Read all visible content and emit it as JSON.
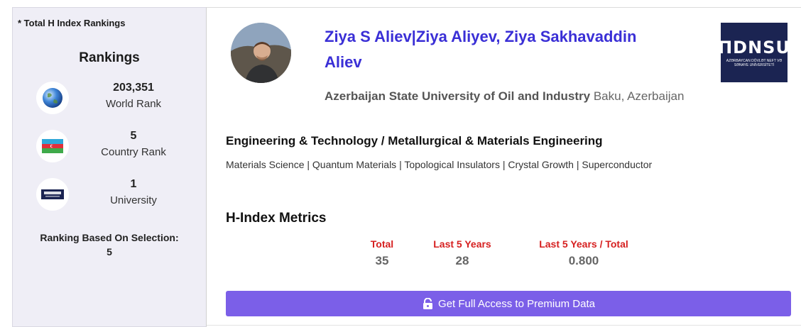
{
  "sidebar": {
    "note": "* Total H Index Rankings",
    "title": "Rankings",
    "ranks": [
      {
        "value": "203,351",
        "label": "World Rank",
        "icon": "globe-icon"
      },
      {
        "value": "5",
        "label": "Country Rank",
        "icon": "azerbaijan-flag-icon"
      },
      {
        "value": "1",
        "label": "University",
        "icon": "university-logo-icon"
      }
    ],
    "selection_label": "Ranking Based On Selection:",
    "selection_value": "5"
  },
  "profile": {
    "name": "Ziya S Aliev|Ziya Aliyev, Ziya Sakhavaddin Aliev",
    "institution": "Azerbaijan State University of Oil and Industry",
    "location": "Baku, Azerbaijan",
    "logo_text": "ΠDNSU",
    "logo_subtext": "AZƏRBAYCAN DÖVLƏT NEFT VƏ SƏNAYE UNİVERSİTETİ",
    "field": "Engineering & Technology / Metallurgical & Materials Engineering",
    "keywords": "Materials Science | Quantum Materials | Topological Insulators | Crystal Growth | Superconductor"
  },
  "metrics": {
    "title": "H-Index Metrics",
    "items": [
      {
        "label": "Total",
        "value": "35"
      },
      {
        "label": "Last 5 Years",
        "value": "28"
      },
      {
        "label": "Last 5 Years / Total",
        "value": "0.800"
      }
    ]
  },
  "premium": {
    "label": "Get Full Access to Premium Data"
  },
  "colors": {
    "accent": "#7b5fe8",
    "name": "#3a2fd6",
    "metric_label": "#d62020",
    "logo_bg": "#1b2452"
  }
}
